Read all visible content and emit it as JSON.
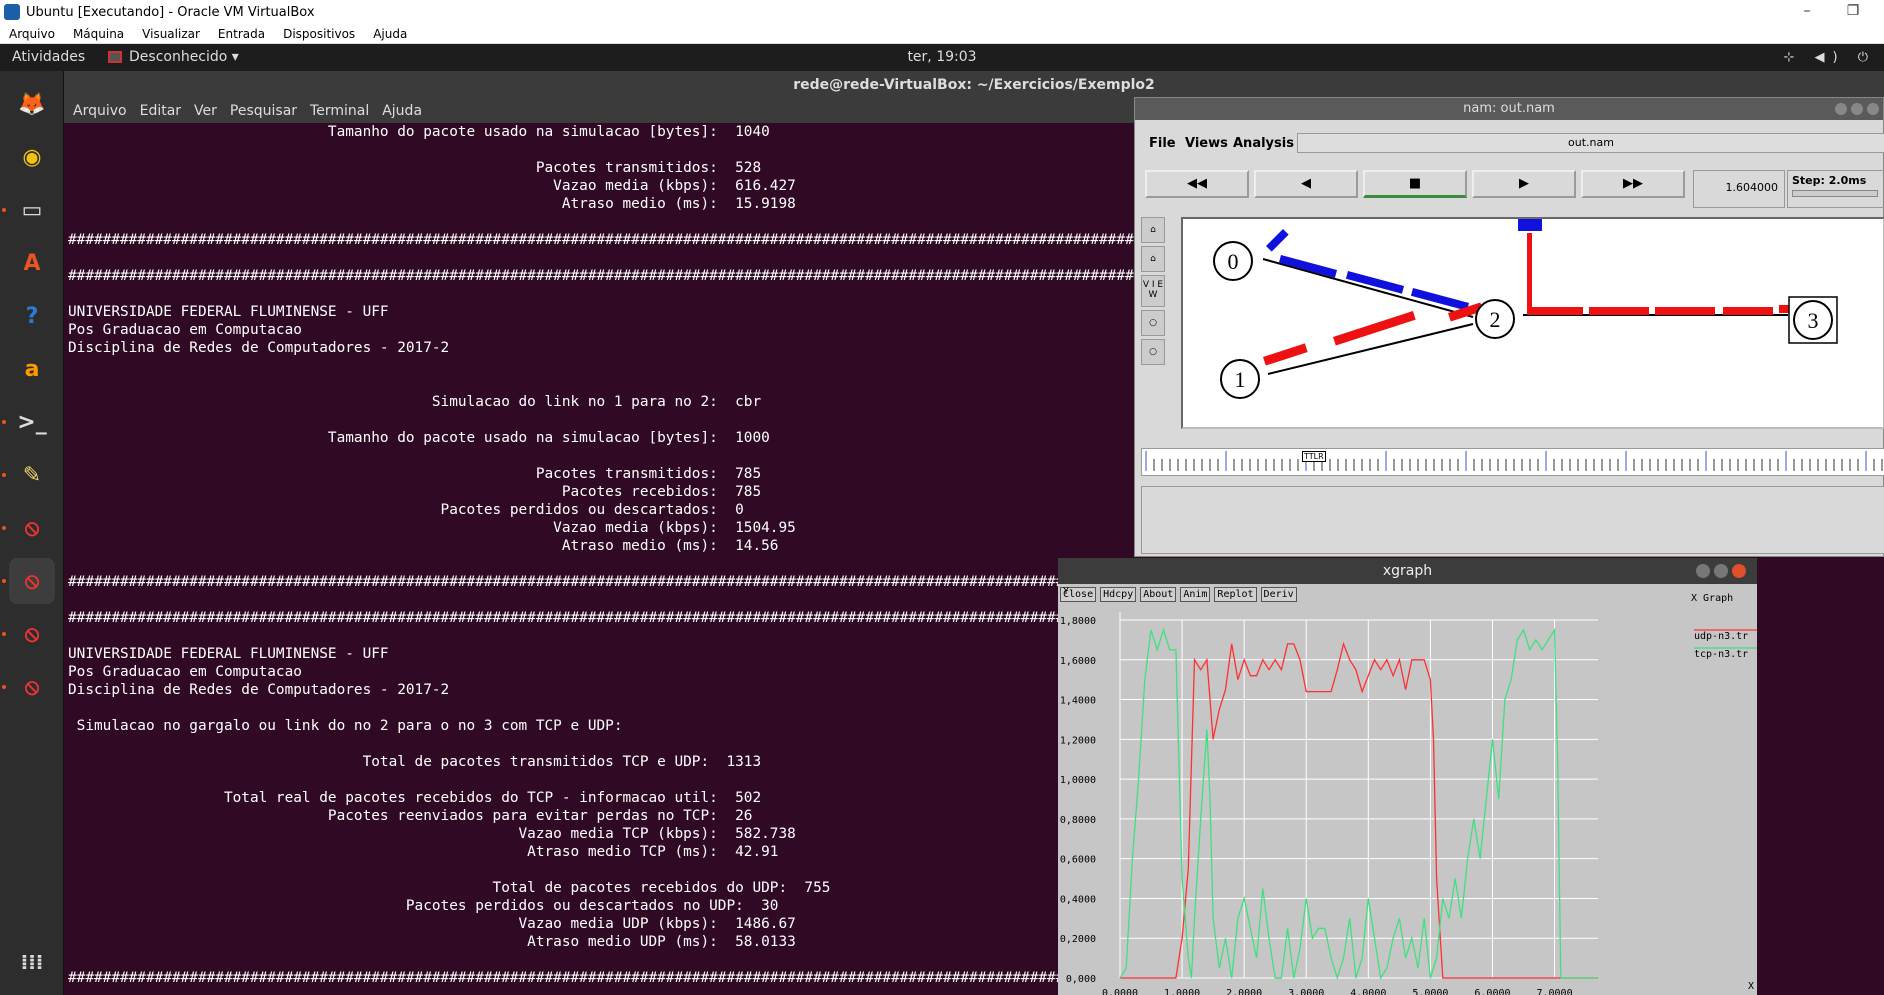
{
  "vbox": {
    "title": "Ubuntu [Executando] - Oracle VM VirtualBox",
    "controls": [
      "–",
      "❐"
    ],
    "menu": [
      "Arquivo",
      "Máquina",
      "Visualizar",
      "Entrada",
      "Dispositivos",
      "Ajuda"
    ]
  },
  "topbar": {
    "activities": "Atividades",
    "app": "Desconhecido ▾",
    "clock": "ter, 19:03",
    "tray": "⊹ ◀) ⏻"
  },
  "dock": {
    "items": [
      {
        "name": "firefox-icon",
        "glyph": "🦊",
        "color": "#e66000"
      },
      {
        "name": "rhythmbox-icon",
        "glyph": "◉",
        "color": "#f5c211"
      },
      {
        "name": "files-icon",
        "glyph": "▭",
        "color": "#ddd"
      },
      {
        "name": "software-center-icon",
        "glyph": "A",
        "color": "#e95420"
      },
      {
        "name": "help-icon",
        "glyph": "?",
        "color": "#2a7bd3"
      },
      {
        "name": "amazon-icon",
        "glyph": "a",
        "color": "#ff9900"
      },
      {
        "name": "terminal-icon",
        "glyph": ">_",
        "color": "#ddd"
      },
      {
        "name": "text-editor-icon",
        "glyph": "✎",
        "color": "#f3d36b"
      },
      {
        "name": "unknown-app-icon-1",
        "glyph": "⦸",
        "color": "#e33"
      },
      {
        "name": "unknown-app-icon-2",
        "glyph": "⦸",
        "color": "#e33"
      },
      {
        "name": "unknown-app-icon-3",
        "glyph": "⦸",
        "color": "#e33"
      },
      {
        "name": "unknown-app-icon-4",
        "glyph": "⦸",
        "color": "#e33"
      }
    ],
    "apps_grid": "⁞⁞⁞"
  },
  "terminal": {
    "title": "rede@rede-VirtualBox: ~/Exercicios/Exemplo2",
    "menu": [
      "Arquivo",
      "Editar",
      "Ver",
      "Pesquisar",
      "Terminal",
      "Ajuda"
    ],
    "lines": [
      "                              Tamanho do pacote usado na simulacao [bytes]:  1040",
      "",
      "                                                      Pacotes transmitidos:  528",
      "                                                        Vazao media (kbps):  616.427",
      "                                                         Atraso medio (ms):  15.9198",
      "",
      "############################################################################################################################",
      "",
      "############################################################################################################################",
      "",
      "UNIVERSIDADE FEDERAL FLUMINENSE - UFF",
      "Pos Graduacao em Computacao",
      "Disciplina de Redes de Computadores - 2017-2",
      "",
      "",
      "                                          Simulacao do link no 1 para no 2:  cbr",
      "",
      "                              Tamanho do pacote usado na simulacao [bytes]:  1000",
      "",
      "                                                      Pacotes transmitidos:  785",
      "                                                         Pacotes recebidos:  785",
      "                                           Pacotes perdidos ou descartados:  0",
      "                                                        Vazao media (kbps):  1504.95",
      "                                                         Atraso medio (ms):  14.56",
      "",
      "############################################################################################################################",
      "",
      "############################################################################################################################",
      "",
      "UNIVERSIDADE FEDERAL FLUMINENSE - UFF",
      "Pos Graduacao em Computacao",
      "Disciplina de Redes de Computadores - 2017-2",
      "",
      " Simulacao no gargalo ou link do no 2 para o no 3 com TCP e UDP:",
      "",
      "                                  Total de pacotes transmitidos TCP e UDP:  1313",
      "",
      "                  Total real de pacotes recebidos do TCP - informacao util:  502",
      "                              Pacotes reenviados para evitar perdas no TCP:  26",
      "                                                    Vazao media TCP (kbps):  582.738",
      "                                                     Atraso medio TCP (ms):  42.91",
      "",
      "                                                 Total de pacotes recebidos do UDP:  755",
      "                                       Pacotes perdidos ou descartados no UDP:  30",
      "                                                    Vazao media UDP (kbps):  1486.67",
      "                                                     Atraso medio UDP (ms):  58.0133",
      "",
      "############################################################################################################################"
    ]
  },
  "nam": {
    "title": "nam: out.nam",
    "menu": [
      "File",
      "Views",
      "Analysis"
    ],
    "file": "out.nam",
    "controls": [
      "◀◀",
      "◀",
      "■",
      "▶",
      "▶▶"
    ],
    "time": "1.604000",
    "step": "Step: 2.0ms",
    "side_buttons": [
      "⌂",
      "⌂",
      "V I E W",
      "○",
      "○"
    ],
    "nodes": [
      "0",
      "1",
      "2",
      "3"
    ],
    "timeline_label": "TTLR"
  },
  "xgraph": {
    "title": "xgraph",
    "buttons": [
      "Close",
      "Hdcpy",
      "About",
      "Anim",
      "Replot",
      "Deriv"
    ],
    "chart_data": {
      "type": "line",
      "title": "X Graph",
      "xlabel": "X",
      "ylabel": "Y",
      "xlim": [
        0,
        7.7
      ],
      "ylim": [
        0,
        1.8
      ],
      "x_ticks": [
        "0,0000",
        "1,0000",
        "2,0000",
        "3,0000",
        "4,0000",
        "5,0000",
        "6,0000",
        "7,0000"
      ],
      "y_ticks": [
        "0,000",
        "0,2000",
        "0,4000",
        "0,6000",
        "0,8000",
        "1,0000",
        "1,2000",
        "1,4000",
        "1,6000",
        "1,8000"
      ],
      "grid": true,
      "legend": "top-right",
      "series": [
        {
          "name": "udp-n3.tr",
          "color": "#ff3030",
          "x": [
            0,
            0.9,
            1.0,
            1.1,
            1.2,
            1.3,
            1.4,
            1.5,
            1.6,
            1.7,
            1.8,
            1.9,
            2.0,
            2.1,
            2.2,
            2.3,
            2.4,
            2.5,
            2.6,
            2.7,
            2.8,
            2.9,
            3.0,
            3.1,
            3.2,
            3.3,
            3.4,
            3.5,
            3.6,
            3.7,
            3.8,
            3.9,
            4.0,
            4.1,
            4.2,
            4.3,
            4.4,
            4.5,
            4.6,
            4.7,
            4.8,
            4.9,
            5.0,
            5.05,
            5.1,
            5.2,
            5.3,
            7.7
          ],
          "values": [
            0,
            0,
            0.2,
            0.55,
            1.6,
            1.55,
            1.6,
            1.2,
            1.35,
            1.45,
            1.68,
            1.5,
            1.6,
            1.52,
            1.52,
            1.6,
            1.55,
            1.6,
            1.55,
            1.68,
            1.68,
            1.6,
            1.44,
            1.44,
            1.44,
            1.44,
            1.44,
            1.55,
            1.68,
            1.6,
            1.55,
            1.44,
            1.52,
            1.6,
            1.55,
            1.6,
            1.52,
            1.6,
            1.45,
            1.6,
            1.6,
            1.6,
            1.5,
            1.2,
            0.5,
            0,
            0,
            0
          ]
        },
        {
          "name": "tcp-n3.tr",
          "color": "#40e080",
          "x": [
            0,
            0.1,
            0.2,
            0.3,
            0.4,
            0.5,
            0.6,
            0.7,
            0.8,
            0.9,
            1.0,
            1.1,
            1.15,
            1.2,
            1.3,
            1.4,
            1.45,
            1.5,
            1.6,
            1.7,
            1.8,
            1.9,
            2.0,
            2.1,
            2.2,
            2.3,
            2.4,
            2.5,
            2.6,
            2.7,
            2.8,
            2.9,
            3.0,
            3.1,
            3.2,
            3.3,
            3.4,
            3.5,
            3.6,
            3.7,
            3.8,
            3.9,
            4.0,
            4.1,
            4.2,
            4.3,
            4.4,
            4.5,
            4.6,
            4.7,
            4.8,
            4.9,
            5.0,
            5.1,
            5.2,
            5.3,
            5.4,
            5.5,
            5.6,
            5.7,
            5.8,
            5.9,
            6.0,
            6.1,
            6.2,
            6.3,
            6.4,
            6.5,
            6.6,
            6.7,
            6.8,
            6.9,
            7.0,
            7.05,
            7.1,
            7.2,
            7.7
          ],
          "values": [
            0,
            0.05,
            0.6,
            1.0,
            1.5,
            1.75,
            1.65,
            1.75,
            1.65,
            1.65,
            0.5,
            0.1,
            0,
            0.3,
            0.8,
            1.25,
            0.9,
            0.3,
            0.05,
            0.2,
            0,
            0.3,
            0.4,
            0.25,
            0.1,
            0.45,
            0.2,
            0,
            0,
            0.25,
            0,
            0.15,
            0.4,
            0.2,
            0.25,
            0.25,
            0.1,
            0,
            0.1,
            0.3,
            0,
            0.1,
            0.4,
            0.2,
            0,
            0.05,
            0.2,
            0.3,
            0.1,
            0.2,
            0.05,
            0.3,
            0,
            0.1,
            0.4,
            0.3,
            0.5,
            0.3,
            0.6,
            0.8,
            0.6,
            0.9,
            1.2,
            0.9,
            1.4,
            1.5,
            1.7,
            1.75,
            1.65,
            1.7,
            1.65,
            1.7,
            1.75,
            1.1,
            0,
            0,
            0
          ]
        }
      ]
    }
  }
}
